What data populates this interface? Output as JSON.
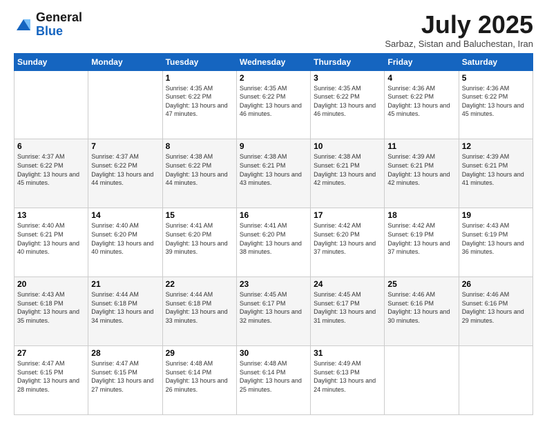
{
  "header": {
    "logo_line1": "General",
    "logo_line2": "Blue",
    "month_title": "July 2025",
    "subtitle": "Sarbaz, Sistan and Baluchestan, Iran"
  },
  "days_of_week": [
    "Sunday",
    "Monday",
    "Tuesday",
    "Wednesday",
    "Thursday",
    "Friday",
    "Saturday"
  ],
  "weeks": [
    [
      {
        "day": "",
        "text": ""
      },
      {
        "day": "",
        "text": ""
      },
      {
        "day": "1",
        "text": "Sunrise: 4:35 AM\nSunset: 6:22 PM\nDaylight: 13 hours and 47 minutes."
      },
      {
        "day": "2",
        "text": "Sunrise: 4:35 AM\nSunset: 6:22 PM\nDaylight: 13 hours and 46 minutes."
      },
      {
        "day": "3",
        "text": "Sunrise: 4:35 AM\nSunset: 6:22 PM\nDaylight: 13 hours and 46 minutes."
      },
      {
        "day": "4",
        "text": "Sunrise: 4:36 AM\nSunset: 6:22 PM\nDaylight: 13 hours and 45 minutes."
      },
      {
        "day": "5",
        "text": "Sunrise: 4:36 AM\nSunset: 6:22 PM\nDaylight: 13 hours and 45 minutes."
      }
    ],
    [
      {
        "day": "6",
        "text": "Sunrise: 4:37 AM\nSunset: 6:22 PM\nDaylight: 13 hours and 45 minutes."
      },
      {
        "day": "7",
        "text": "Sunrise: 4:37 AM\nSunset: 6:22 PM\nDaylight: 13 hours and 44 minutes."
      },
      {
        "day": "8",
        "text": "Sunrise: 4:38 AM\nSunset: 6:22 PM\nDaylight: 13 hours and 44 minutes."
      },
      {
        "day": "9",
        "text": "Sunrise: 4:38 AM\nSunset: 6:21 PM\nDaylight: 13 hours and 43 minutes."
      },
      {
        "day": "10",
        "text": "Sunrise: 4:38 AM\nSunset: 6:21 PM\nDaylight: 13 hours and 42 minutes."
      },
      {
        "day": "11",
        "text": "Sunrise: 4:39 AM\nSunset: 6:21 PM\nDaylight: 13 hours and 42 minutes."
      },
      {
        "day": "12",
        "text": "Sunrise: 4:39 AM\nSunset: 6:21 PM\nDaylight: 13 hours and 41 minutes."
      }
    ],
    [
      {
        "day": "13",
        "text": "Sunrise: 4:40 AM\nSunset: 6:21 PM\nDaylight: 13 hours and 40 minutes."
      },
      {
        "day": "14",
        "text": "Sunrise: 4:40 AM\nSunset: 6:20 PM\nDaylight: 13 hours and 40 minutes."
      },
      {
        "day": "15",
        "text": "Sunrise: 4:41 AM\nSunset: 6:20 PM\nDaylight: 13 hours and 39 minutes."
      },
      {
        "day": "16",
        "text": "Sunrise: 4:41 AM\nSunset: 6:20 PM\nDaylight: 13 hours and 38 minutes."
      },
      {
        "day": "17",
        "text": "Sunrise: 4:42 AM\nSunset: 6:20 PM\nDaylight: 13 hours and 37 minutes."
      },
      {
        "day": "18",
        "text": "Sunrise: 4:42 AM\nSunset: 6:19 PM\nDaylight: 13 hours and 37 minutes."
      },
      {
        "day": "19",
        "text": "Sunrise: 4:43 AM\nSunset: 6:19 PM\nDaylight: 13 hours and 36 minutes."
      }
    ],
    [
      {
        "day": "20",
        "text": "Sunrise: 4:43 AM\nSunset: 6:18 PM\nDaylight: 13 hours and 35 minutes."
      },
      {
        "day": "21",
        "text": "Sunrise: 4:44 AM\nSunset: 6:18 PM\nDaylight: 13 hours and 34 minutes."
      },
      {
        "day": "22",
        "text": "Sunrise: 4:44 AM\nSunset: 6:18 PM\nDaylight: 13 hours and 33 minutes."
      },
      {
        "day": "23",
        "text": "Sunrise: 4:45 AM\nSunset: 6:17 PM\nDaylight: 13 hours and 32 minutes."
      },
      {
        "day": "24",
        "text": "Sunrise: 4:45 AM\nSunset: 6:17 PM\nDaylight: 13 hours and 31 minutes."
      },
      {
        "day": "25",
        "text": "Sunrise: 4:46 AM\nSunset: 6:16 PM\nDaylight: 13 hours and 30 minutes."
      },
      {
        "day": "26",
        "text": "Sunrise: 4:46 AM\nSunset: 6:16 PM\nDaylight: 13 hours and 29 minutes."
      }
    ],
    [
      {
        "day": "27",
        "text": "Sunrise: 4:47 AM\nSunset: 6:15 PM\nDaylight: 13 hours and 28 minutes."
      },
      {
        "day": "28",
        "text": "Sunrise: 4:47 AM\nSunset: 6:15 PM\nDaylight: 13 hours and 27 minutes."
      },
      {
        "day": "29",
        "text": "Sunrise: 4:48 AM\nSunset: 6:14 PM\nDaylight: 13 hours and 26 minutes."
      },
      {
        "day": "30",
        "text": "Sunrise: 4:48 AM\nSunset: 6:14 PM\nDaylight: 13 hours and 25 minutes."
      },
      {
        "day": "31",
        "text": "Sunrise: 4:49 AM\nSunset: 6:13 PM\nDaylight: 13 hours and 24 minutes."
      },
      {
        "day": "",
        "text": ""
      },
      {
        "day": "",
        "text": ""
      }
    ]
  ]
}
